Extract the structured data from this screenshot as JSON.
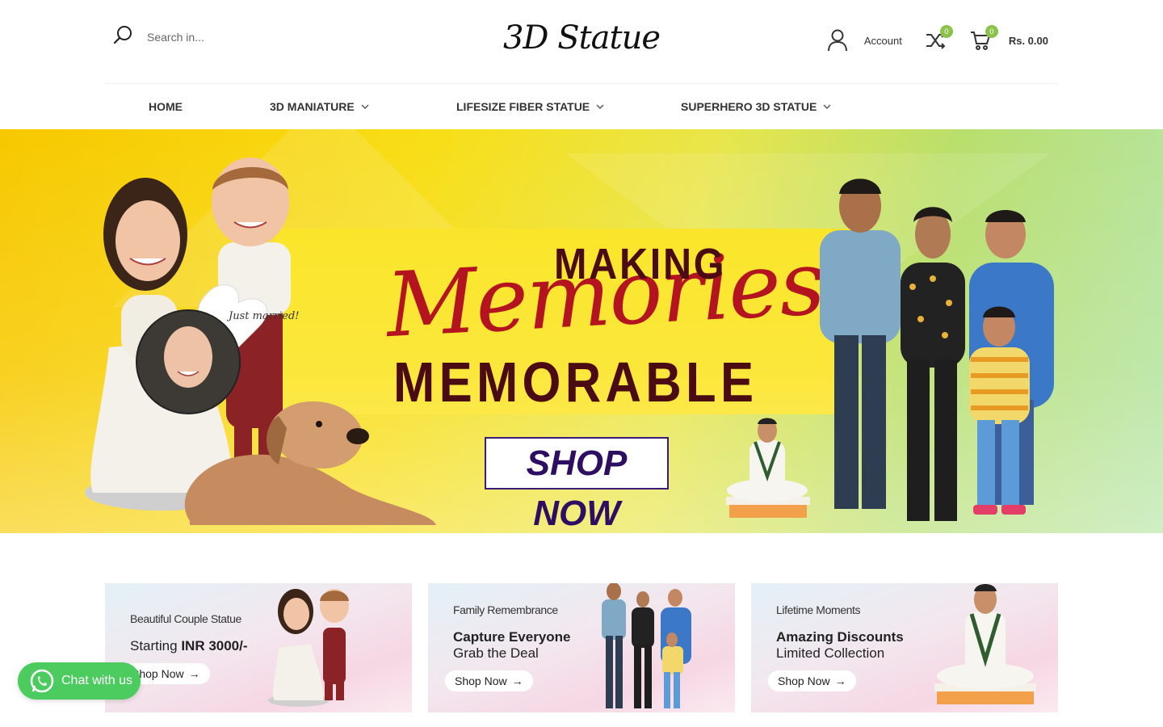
{
  "header": {
    "search_placeholder": "Search in...",
    "logo": "3D Statue",
    "account_label": "Account",
    "compare_count": "0",
    "cart_count": "0",
    "cart_total": "Rs. 0.00"
  },
  "nav": {
    "items": [
      {
        "label": "HOME"
      },
      {
        "label": "3D MANIATURE"
      },
      {
        "label": "LIFESIZE FIBER STATUE"
      },
      {
        "label": "SUPERHERO 3D STATUE"
      }
    ]
  },
  "hero": {
    "line1": "MAKING",
    "line2": "Memories",
    "line3": "MEMORABLE",
    "cta": "SHOP NOW",
    "sign_text": "Just married!"
  },
  "cards": [
    {
      "subtitle": "Beautiful Couple Statue",
      "title_plain": "Starting ",
      "title_bold": "INR 3000/-",
      "title_line2": "",
      "button": "Shop Now"
    },
    {
      "subtitle": "Family Remembrance",
      "title_plain": "",
      "title_bold": "Capture Everyone",
      "title_line2": "Grab the Deal",
      "button": "Shop Now"
    },
    {
      "subtitle": "Lifetime Moments",
      "title_plain": "",
      "title_bold": "Amazing Discounts",
      "title_line2": "Limited Collection",
      "button": "Shop Now"
    }
  ],
  "chat": {
    "label": "Chat with us"
  },
  "colors": {
    "accent_green": "#8bc34a",
    "whatsapp_green": "#4ccb5f",
    "hero_red": "#b4141f",
    "hero_dark": "#4a0b12"
  }
}
